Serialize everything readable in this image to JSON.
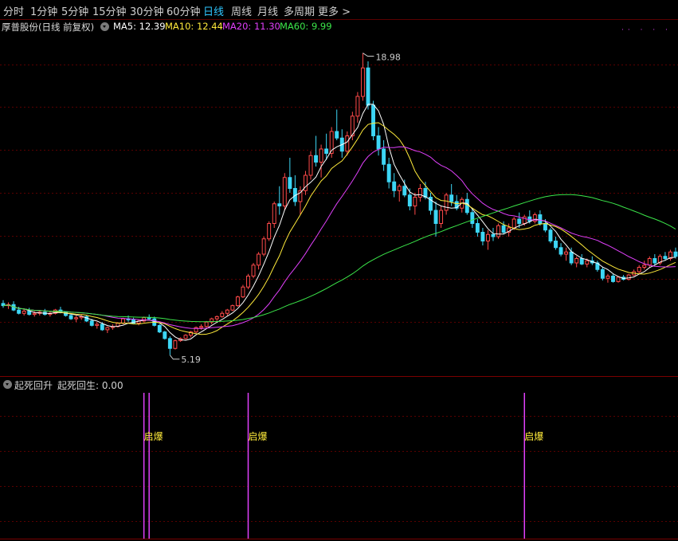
{
  "toolbar": {
    "tabs": [
      {
        "label": "分时"
      },
      {
        "label": "1分钟"
      },
      {
        "label": "5分钟"
      },
      {
        "label": "15分钟"
      },
      {
        "label": "30分钟"
      },
      {
        "label": "60分钟"
      },
      {
        "label": "日线"
      },
      {
        "label": "周线"
      },
      {
        "label": "月线"
      },
      {
        "label": "多周期"
      },
      {
        "label": "更多 >"
      }
    ],
    "active_tab": "日线"
  },
  "main_chart": {
    "stock_title": "厚普股份(日线 前复权)",
    "ma_labels": [
      {
        "text": "MA5: 12.39",
        "color": "#ffffff"
      },
      {
        "text": "MA10: 12.44",
        "color": "#ffeb3b"
      },
      {
        "text": "MA20: 11.30",
        "color": "#e040fb"
      },
      {
        "text": "MA60: 9.99",
        "color": "#3be64a"
      }
    ],
    "high_label": "18.98",
    "low_label": "5.19",
    "dots_text": "·· · · ·"
  },
  "indicator": {
    "title": "起死回升",
    "value_text": "起死回生: 0.00",
    "signals": [
      {
        "label": "启爆"
      },
      {
        "label": "启爆"
      },
      {
        "label": "启爆"
      }
    ]
  },
  "colors": {
    "up": "#ff4a4a",
    "down": "#3dd6f5",
    "ma5": "#ffffff",
    "ma10": "#ffeb3b",
    "ma20": "#e040fb",
    "ma60": "#3be64a",
    "grid": "#5a0000",
    "signal": "#e040fb"
  },
  "chart_data": {
    "type": "candlestick",
    "price_range": [
      4.6,
      19.8
    ],
    "ohlc": [
      [
        7.55,
        7.7,
        7.35,
        7.45
      ],
      [
        7.45,
        7.6,
        7.3,
        7.5
      ],
      [
        7.5,
        7.65,
        7.2,
        7.25
      ],
      [
        7.25,
        7.4,
        7.05,
        7.1
      ],
      [
        7.1,
        7.3,
        7.0,
        7.2
      ],
      [
        7.2,
        7.35,
        7.0,
        7.05
      ],
      [
        7.05,
        7.2,
        6.95,
        7.1
      ],
      [
        7.1,
        7.25,
        7.0,
        7.15
      ],
      [
        7.15,
        7.3,
        7.0,
        7.05
      ],
      [
        7.05,
        7.2,
        6.95,
        7.1
      ],
      [
        7.1,
        7.3,
        7.05,
        7.25
      ],
      [
        7.25,
        7.4,
        7.1,
        7.15
      ],
      [
        7.15,
        7.2,
        6.95,
        7.0
      ],
      [
        7.0,
        7.1,
        6.8,
        6.85
      ],
      [
        6.85,
        7.0,
        6.7,
        6.9
      ],
      [
        6.9,
        7.05,
        6.8,
        6.95
      ],
      [
        6.95,
        7.0,
        6.7,
        6.75
      ],
      [
        6.75,
        6.85,
        6.5,
        6.55
      ],
      [
        6.55,
        6.7,
        6.4,
        6.6
      ],
      [
        6.6,
        6.7,
        6.3,
        6.35
      ],
      [
        6.35,
        6.5,
        6.2,
        6.45
      ],
      [
        6.45,
        6.6,
        6.35,
        6.5
      ],
      [
        6.5,
        6.7,
        6.45,
        6.65
      ],
      [
        6.65,
        6.9,
        6.6,
        6.85
      ],
      [
        6.85,
        7.0,
        6.7,
        6.8
      ],
      [
        6.8,
        6.9,
        6.6,
        6.65
      ],
      [
        6.65,
        6.8,
        6.55,
        6.75
      ],
      [
        6.75,
        6.95,
        6.7,
        6.9
      ],
      [
        6.9,
        7.05,
        6.8,
        6.85
      ],
      [
        6.85,
        6.95,
        6.5,
        6.55
      ],
      [
        6.55,
        6.6,
        6.2,
        6.25
      ],
      [
        6.25,
        6.3,
        5.9,
        5.95
      ],
      [
        5.95,
        6.05,
        5.19,
        5.5
      ],
      [
        5.5,
        5.9,
        5.45,
        5.85
      ],
      [
        5.85,
        6.0,
        5.8,
        5.95
      ],
      [
        5.95,
        6.15,
        5.9,
        6.1
      ],
      [
        6.1,
        6.3,
        6.0,
        6.25
      ],
      [
        6.25,
        6.5,
        6.2,
        6.45
      ],
      [
        6.45,
        6.6,
        6.35,
        6.5
      ],
      [
        6.5,
        6.75,
        6.45,
        6.7
      ],
      [
        6.7,
        6.9,
        6.6,
        6.85
      ],
      [
        6.85,
        7.0,
        6.75,
        6.95
      ],
      [
        6.95,
        7.2,
        6.9,
        7.1
      ],
      [
        7.1,
        7.3,
        7.0,
        7.25
      ],
      [
        7.25,
        7.5,
        7.2,
        7.45
      ],
      [
        7.45,
        7.9,
        7.4,
        7.85
      ],
      [
        7.85,
        8.4,
        7.8,
        8.3
      ],
      [
        8.3,
        8.9,
        8.2,
        8.8
      ],
      [
        8.8,
        9.4,
        8.7,
        9.3
      ],
      [
        9.3,
        9.9,
        9.1,
        9.8
      ],
      [
        9.8,
        10.6,
        9.7,
        10.5
      ],
      [
        10.5,
        11.3,
        10.4,
        11.2
      ],
      [
        11.2,
        12.2,
        11.0,
        12.1
      ],
      [
        12.1,
        12.9,
        11.6,
        12.0
      ],
      [
        12.0,
        13.5,
        11.8,
        13.3
      ],
      [
        13.3,
        14.2,
        12.6,
        12.8
      ],
      [
        12.8,
        13.4,
        12.0,
        12.2
      ],
      [
        12.2,
        12.9,
        11.6,
        12.7
      ],
      [
        12.7,
        13.6,
        12.5,
        13.4
      ],
      [
        13.4,
        14.5,
        13.2,
        14.3
      ],
      [
        14.3,
        15.2,
        13.8,
        14.0
      ],
      [
        14.0,
        14.8,
        13.3,
        14.6
      ],
      [
        14.6,
        15.3,
        14.1,
        14.4
      ],
      [
        14.4,
        15.6,
        14.2,
        15.4
      ],
      [
        15.4,
        16.4,
        15.0,
        15.1
      ],
      [
        15.1,
        15.5,
        14.2,
        14.5
      ],
      [
        14.5,
        15.4,
        14.3,
        15.2
      ],
      [
        15.2,
        16.3,
        15.0,
        16.1
      ],
      [
        16.1,
        17.2,
        15.8,
        17.0
      ],
      [
        17.0,
        18.98,
        16.8,
        18.3
      ],
      [
        18.3,
        18.6,
        16.4,
        16.6
      ],
      [
        16.6,
        16.8,
        15.0,
        15.2
      ],
      [
        15.2,
        15.6,
        14.3,
        14.6
      ],
      [
        14.6,
        15.0,
        13.6,
        13.9
      ],
      [
        13.9,
        14.2,
        12.8,
        13.1
      ],
      [
        13.1,
        13.5,
        12.4,
        12.7
      ],
      [
        12.7,
        13.0,
        12.2,
        12.9
      ],
      [
        12.9,
        13.2,
        12.4,
        12.5
      ],
      [
        12.5,
        12.8,
        11.8,
        12.0
      ],
      [
        12.0,
        12.6,
        11.6,
        12.4
      ],
      [
        12.4,
        13.0,
        12.2,
        12.8
      ],
      [
        12.8,
        13.1,
        12.3,
        12.4
      ],
      [
        12.4,
        12.6,
        11.6,
        11.8
      ],
      [
        11.8,
        12.2,
        10.6,
        11.2
      ],
      [
        11.2,
        12.0,
        11.0,
        11.8
      ],
      [
        11.8,
        12.6,
        11.6,
        12.5
      ],
      [
        12.5,
        13.0,
        12.0,
        12.2
      ],
      [
        12.2,
        12.5,
        11.8,
        11.9
      ],
      [
        11.9,
        12.4,
        11.7,
        12.3
      ],
      [
        12.3,
        12.6,
        11.6,
        11.7
      ],
      [
        11.7,
        11.9,
        11.0,
        11.2
      ],
      [
        11.2,
        11.4,
        10.6,
        10.8
      ],
      [
        10.8,
        11.0,
        10.2,
        10.4
      ],
      [
        10.4,
        10.9,
        10.0,
        10.7
      ],
      [
        10.7,
        11.0,
        10.4,
        10.6
      ],
      [
        10.6,
        11.2,
        10.5,
        11.1
      ],
      [
        11.1,
        11.3,
        10.7,
        10.8
      ],
      [
        10.8,
        11.2,
        10.6,
        11.0
      ],
      [
        11.0,
        11.5,
        10.9,
        11.4
      ],
      [
        11.4,
        11.7,
        11.0,
        11.2
      ],
      [
        11.2,
        11.6,
        11.1,
        11.5
      ],
      [
        11.5,
        11.8,
        11.2,
        11.3
      ],
      [
        11.3,
        11.7,
        11.2,
        11.6
      ],
      [
        11.6,
        11.8,
        11.1,
        11.2
      ],
      [
        11.2,
        11.4,
        10.8,
        10.9
      ],
      [
        10.9,
        11.0,
        10.3,
        10.4
      ],
      [
        10.4,
        10.6,
        10.0,
        10.1
      ],
      [
        10.1,
        10.3,
        9.7,
        9.8
      ],
      [
        9.8,
        10.1,
        9.5,
        9.9
      ],
      [
        9.9,
        10.1,
        9.3,
        9.4
      ],
      [
        9.4,
        9.7,
        9.2,
        9.6
      ],
      [
        9.6,
        9.8,
        9.3,
        9.35
      ],
      [
        9.35,
        9.6,
        9.2,
        9.5
      ],
      [
        9.5,
        9.7,
        9.3,
        9.4
      ],
      [
        9.4,
        9.5,
        9.0,
        9.1
      ],
      [
        9.1,
        9.2,
        8.6,
        8.7
      ],
      [
        8.7,
        8.9,
        8.5,
        8.8
      ],
      [
        8.8,
        8.9,
        8.5,
        8.55
      ],
      [
        8.55,
        8.8,
        8.5,
        8.75
      ],
      [
        8.75,
        8.85,
        8.6,
        8.65
      ],
      [
        8.65,
        8.9,
        8.6,
        8.85
      ],
      [
        8.85,
        9.1,
        8.8,
        9.0
      ],
      [
        9.0,
        9.3,
        8.9,
        9.2
      ],
      [
        9.2,
        9.5,
        9.1,
        9.3
      ],
      [
        9.3,
        9.7,
        9.2,
        9.6
      ],
      [
        9.6,
        9.8,
        9.3,
        9.4
      ],
      [
        9.4,
        9.8,
        9.3,
        9.7
      ],
      [
        9.7,
        9.9,
        9.5,
        9.6
      ],
      [
        9.6,
        10.0,
        9.5,
        9.9
      ],
      [
        9.9,
        10.1,
        9.6,
        9.7
      ]
    ],
    "signal_bar_indices": [
      27,
      28,
      47,
      100
    ]
  }
}
